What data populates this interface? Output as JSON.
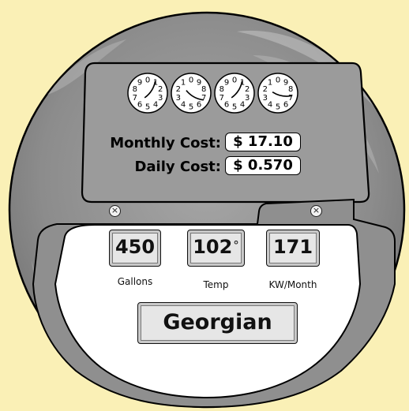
{
  "colors": {
    "background": "#FAF0B6",
    "globe": "#8E8E8E",
    "panel": "#9B9B9B",
    "lower_panel": "#FFFFFF",
    "readout_fill": "#E6E6E6"
  },
  "dials": {
    "numerals": [
      "0",
      "1",
      "2",
      "3",
      "4",
      "5",
      "6",
      "7",
      "8",
      "9"
    ],
    "readings": [
      0.9,
      6.7,
      0.9,
      7.2
    ]
  },
  "costs": {
    "monthly_label": "Monthly Cost:",
    "monthly_value": "$ 17.10",
    "daily_label": "Daily Cost:",
    "daily_value": "$ 0.570"
  },
  "close_buttons": {
    "symbol": "×"
  },
  "readouts": {
    "gallons": {
      "value": "450",
      "label": "Gallons"
    },
    "temp": {
      "value": "102",
      "unit": "°",
      "label": "Temp"
    },
    "kw": {
      "value": "171",
      "label": "KW/Month"
    }
  },
  "style_button": {
    "label": "Georgian"
  }
}
